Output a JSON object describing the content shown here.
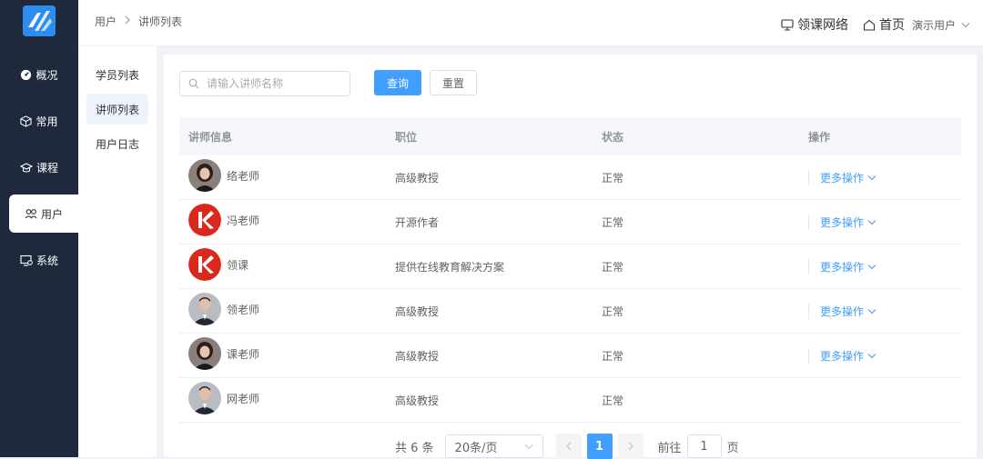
{
  "sidebar": {
    "items": [
      {
        "label": "概况",
        "icon": "dashboard-icon"
      },
      {
        "label": "常用",
        "icon": "cube-icon"
      },
      {
        "label": "课程",
        "icon": "graduation-cap-icon"
      },
      {
        "label": "用户",
        "icon": "users-icon",
        "active": true
      },
      {
        "label": "系统",
        "icon": "monitor-settings-icon"
      }
    ]
  },
  "subnav": {
    "items": [
      {
        "label": "学员列表"
      },
      {
        "label": "讲师列表",
        "active": true
      },
      {
        "label": "用户日志"
      }
    ]
  },
  "header": {
    "breadcrumb": [
      "用户",
      "讲师列表"
    ],
    "site_link": "领课网络",
    "home_link": "首页",
    "user_name": "演示用户"
  },
  "search": {
    "placeholder": "请输入讲师名称",
    "value": ""
  },
  "buttons": {
    "query": "查询",
    "reset": "重置"
  },
  "table": {
    "columns": [
      "讲师信息",
      "职位",
      "状态",
      "操作"
    ],
    "rows": [
      {
        "name": "络老师",
        "position": "高级教授",
        "status": "正常",
        "action": "更多操作",
        "avatar": "woman"
      },
      {
        "name": "冯老师",
        "position": "开源作者",
        "status": "正常",
        "action": "更多操作",
        "avatar": "logo"
      },
      {
        "name": "领课",
        "position": "提供在线教育解决方案",
        "status": "正常",
        "action": "更多操作",
        "avatar": "logo"
      },
      {
        "name": "领老师",
        "position": "高级教授",
        "status": "正常",
        "action": "更多操作",
        "avatar": "man"
      },
      {
        "name": "课老师",
        "position": "高级教授",
        "status": "正常",
        "action": "更多操作",
        "avatar": "woman"
      },
      {
        "name": "网老师",
        "position": "高级教授",
        "status": "正常",
        "action": "",
        "avatar": "man"
      }
    ]
  },
  "pagination": {
    "total_text": "共 6 条",
    "page_size": "20条/页",
    "current_page": "1",
    "goto_prefix": "前往",
    "goto_value": "1",
    "goto_suffix": "页"
  },
  "colors": {
    "sidebar_bg": "#1e2a3c",
    "accent": "#409eff",
    "logo_red": "#d9281c"
  }
}
